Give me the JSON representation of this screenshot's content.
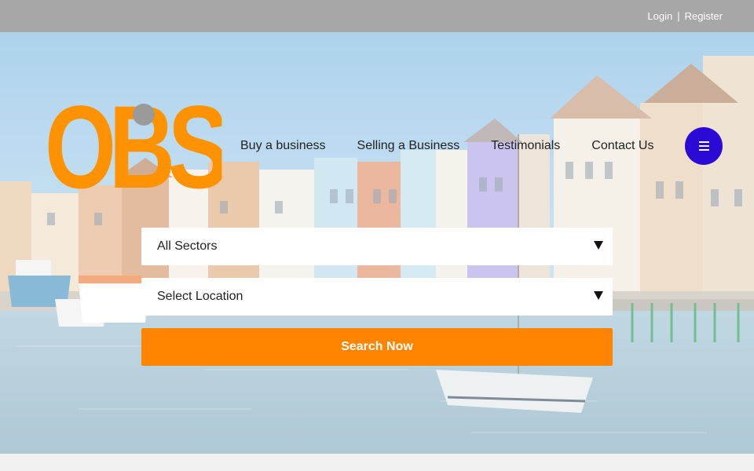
{
  "topbar": {
    "login": "Login",
    "separator": "|",
    "register": "Register"
  },
  "logo": {
    "text": "OBS",
    "color": "#ff9200"
  },
  "nav": {
    "items": [
      {
        "label": "Buy a business"
      },
      {
        "label": "Selling a Business"
      },
      {
        "label": "Testimonials"
      },
      {
        "label": "Contact Us"
      }
    ],
    "menu_icon": "hamburger-icon"
  },
  "search": {
    "sector": {
      "selected": "All Sectors"
    },
    "location": {
      "selected": "Select Location"
    },
    "button": "Search Now"
  },
  "colors": {
    "accent": "#ff8500",
    "menu": "#2a0ad4",
    "topbar": "#a7a7a7"
  }
}
